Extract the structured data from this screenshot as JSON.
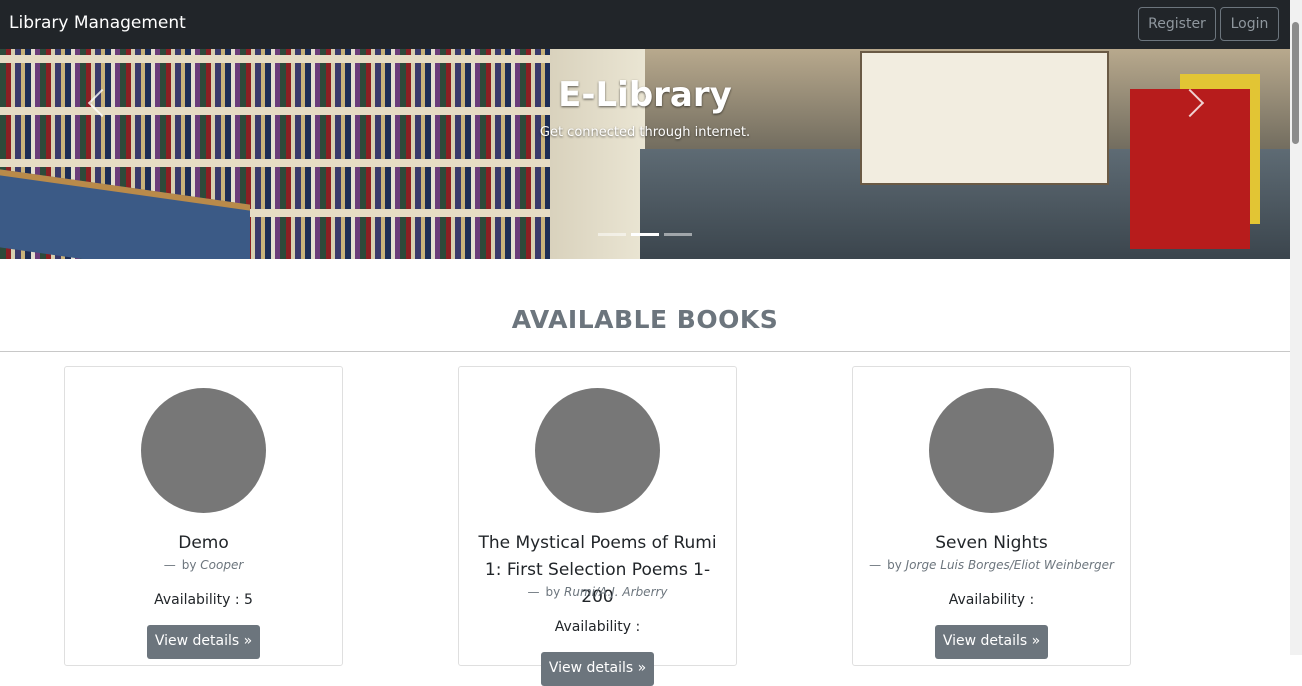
{
  "navbar": {
    "brand": "Library Management",
    "register_label": "Register",
    "login_label": "Login"
  },
  "carousel": {
    "title": "E-Library",
    "caption": "Get connected through internet.",
    "active_slide": 2,
    "slide_count": 3
  },
  "section": {
    "title": "AVAILABLE BOOKS"
  },
  "books": [
    {
      "title": "Demo",
      "by": "by",
      "dash": "—",
      "author": "Cooper",
      "availability": "Availability : 5",
      "details_label": "View details »"
    },
    {
      "title": "The Mystical Poems of Rumi 1: First Selection Poems 1-200",
      "by": "by",
      "dash": "—",
      "author": "Rumi/A.J. Arberry",
      "availability": "Availability :",
      "details_label": "View details »"
    },
    {
      "title": "Seven Nights",
      "by": "by",
      "dash": "—",
      "author": "Jorge Luis Borges/Eliot Weinberger",
      "availability": "Availability :",
      "details_label": "View details »"
    }
  ],
  "colors": {
    "navbar_bg": "#212529",
    "secondary": "#6c757d",
    "avatar": "#777777"
  }
}
